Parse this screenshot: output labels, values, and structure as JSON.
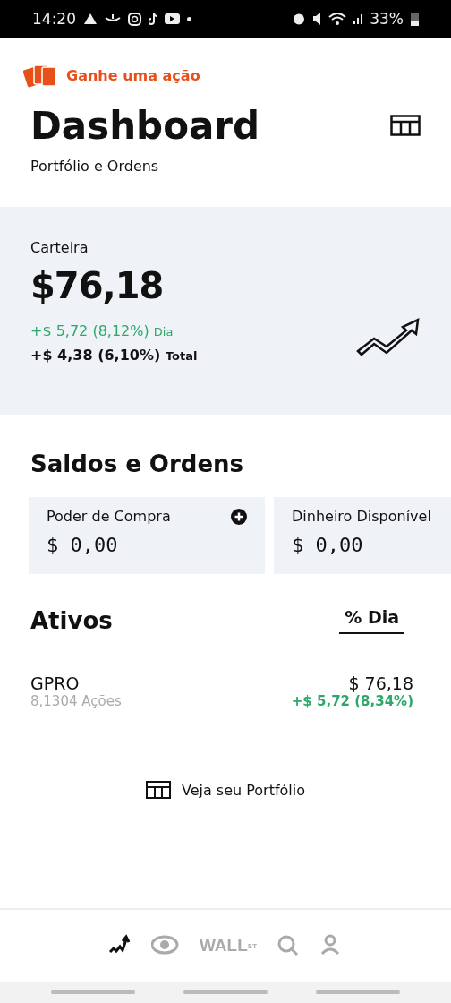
{
  "status_bar": {
    "time": "14:20",
    "battery": "33%"
  },
  "promo": {
    "label": "Ganhe uma ação"
  },
  "header": {
    "title": "Dashboard",
    "subtitle": "Portfólio e Ordens"
  },
  "portfolio": {
    "label": "Carteira",
    "value": "$76,18",
    "day_change": "+$ 5,72 (8,12%)",
    "day_label": "Dia",
    "total_change": "+$ 4,38 (6,10%)",
    "total_label": "Total"
  },
  "balances": {
    "title": "Saldos e Ordens",
    "cards": [
      {
        "label": "Poder de Compra",
        "value": "$ 0,00",
        "action": true
      },
      {
        "label": "Dinheiro Disponível",
        "value": "$ 0,00"
      }
    ]
  },
  "assets": {
    "title": "Ativos",
    "sort_tab": "% Dia",
    "rows": [
      {
        "symbol": "GPRO",
        "shares": "8,1304 Ações",
        "price": "$ 76,18",
        "change": "+$ 5,72 (8,34%)"
      }
    ]
  },
  "portfolio_link": "Veja seu Portfólio",
  "bottom_nav": [
    {
      "kind": "chart",
      "selected": true
    },
    {
      "kind": "eye",
      "selected": false
    },
    {
      "kind": "text",
      "label": "WALL$^{ST}$",
      "selected": false
    },
    {
      "kind": "search",
      "selected": false
    },
    {
      "kind": "profile",
      "selected": false
    }
  ]
}
